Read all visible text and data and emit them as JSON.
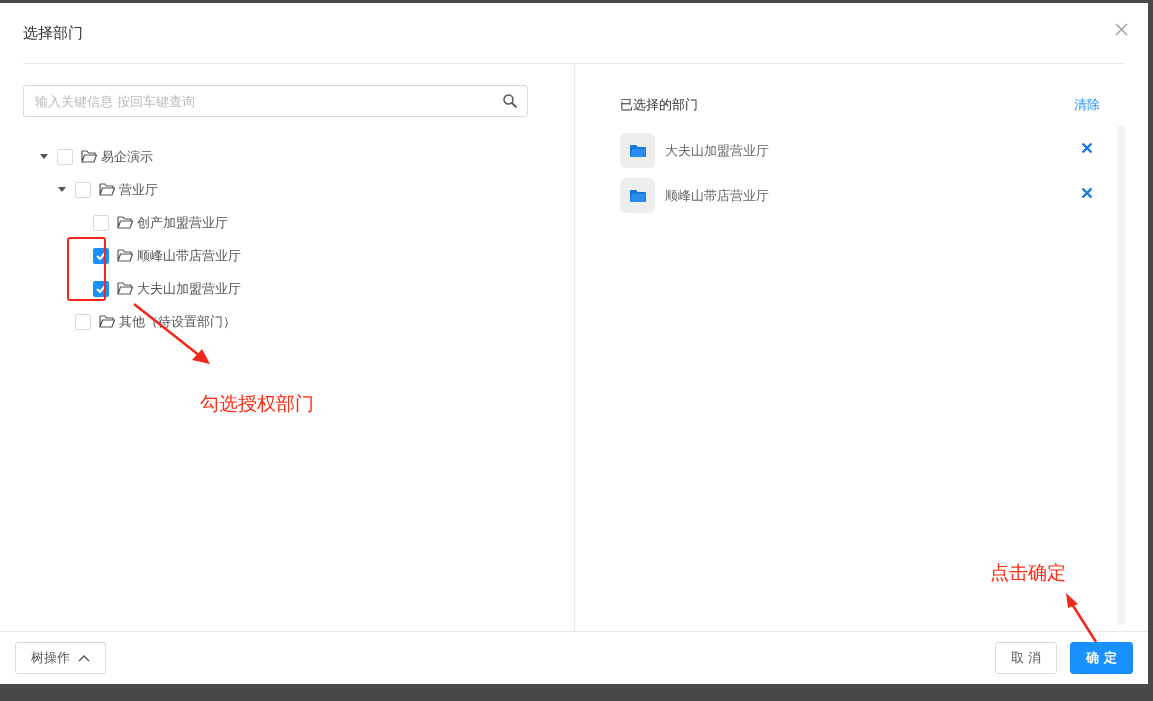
{
  "dialog": {
    "title": "选择部门"
  },
  "search": {
    "placeholder": "输入关键信息 按回车键查询"
  },
  "tree": [
    {
      "label": "易企演示",
      "expanded": true,
      "checked": false,
      "children": [
        {
          "label": "营业厅",
          "expanded": true,
          "checked": false,
          "children": [
            {
              "label": "创产加盟营业厅",
              "checked": false
            },
            {
              "label": "顺峰山带店营业厅",
              "checked": true
            },
            {
              "label": "大夫山加盟营业厅",
              "checked": true
            }
          ]
        },
        {
          "label": "其他（待设置部门）",
          "checked": false
        }
      ]
    }
  ],
  "selected_panel": {
    "title": "已选择的部门",
    "clear_link": "清除",
    "items": [
      {
        "label": "大夫山加盟营业厅"
      },
      {
        "label": "顺峰山带店营业厅"
      }
    ]
  },
  "footer": {
    "tree_menu": "树操作",
    "cancel": "取 消",
    "confirm": "确 定"
  },
  "annotations": [
    {
      "kind": "check",
      "text": "勾选授权部门"
    },
    {
      "kind": "confirm",
      "text": "点击确定"
    }
  ]
}
